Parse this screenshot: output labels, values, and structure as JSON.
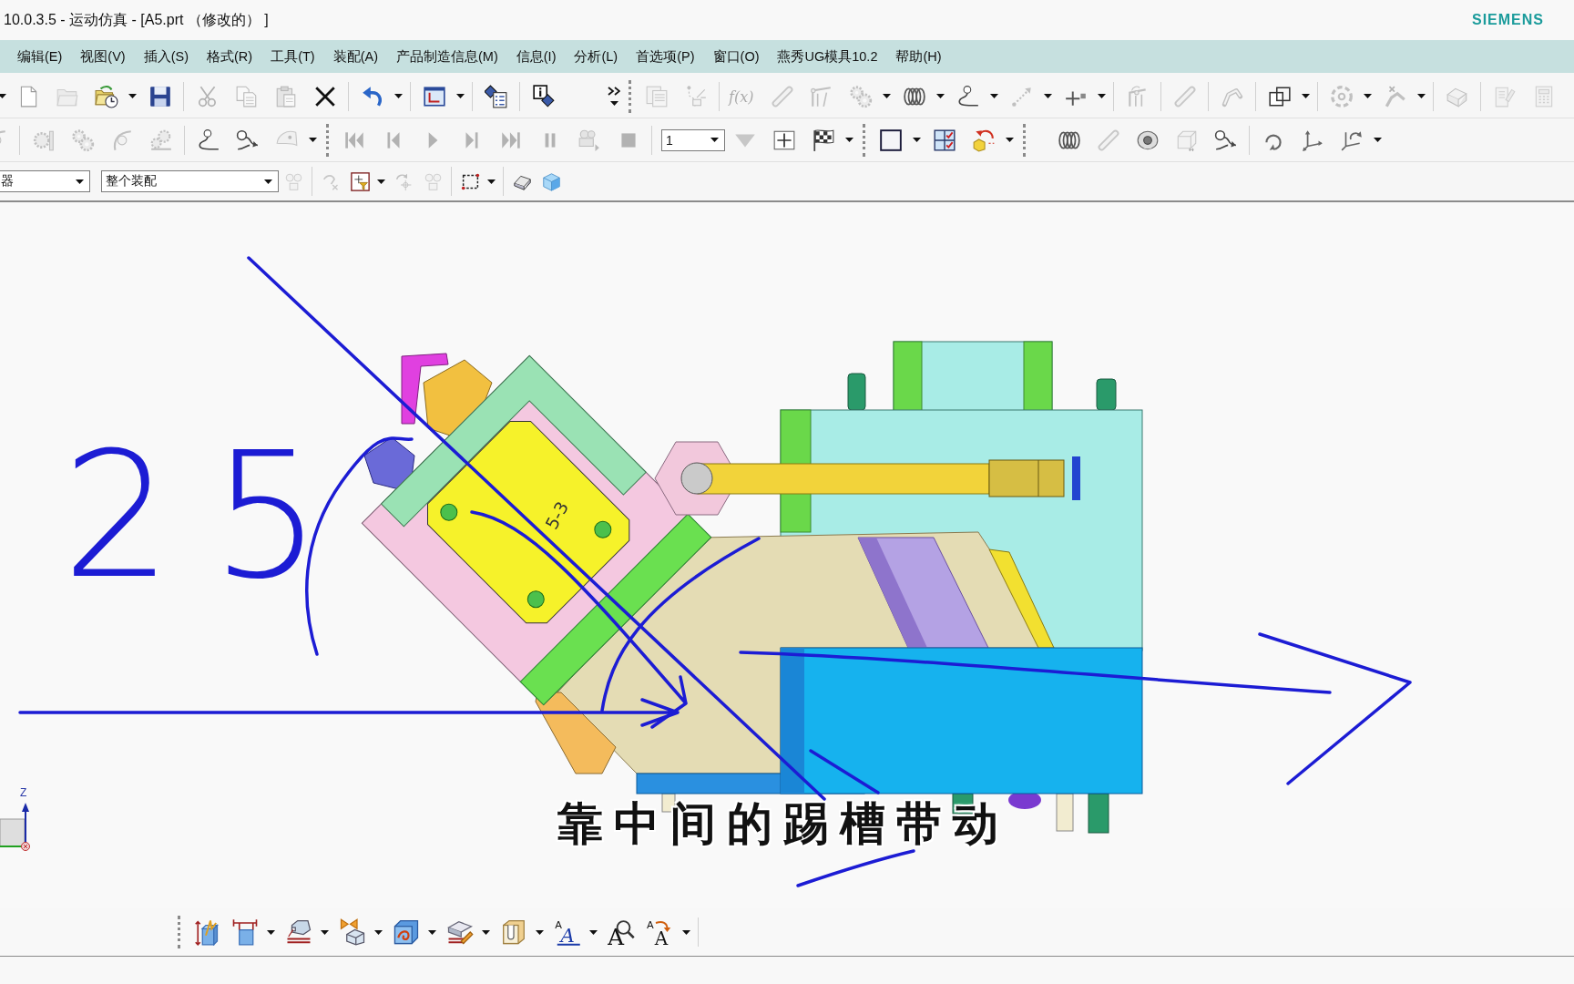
{
  "window": {
    "title": "10.0.3.5 - 运动仿真 - [A5.prt （修改的） ]",
    "brand": "SIEMENS"
  },
  "menu": [
    "编辑(E)",
    "视图(V)",
    "插入(S)",
    "格式(R)",
    "工具(T)",
    "装配(A)",
    "产品制造信息(M)",
    "信息(I)",
    "分析(L)",
    "首选项(P)",
    "窗口(O)",
    "燕秀UG模具10.2",
    "帮助(H)"
  ],
  "toolbars": [
    {
      "leading_caret": true,
      "groups": [
        [
          {
            "kind": "icon",
            "disabled": false,
            "dropdown": false
          },
          {
            "kind": "icon",
            "disabled": true,
            "dropdown": false
          },
          {
            "kind": "icon",
            "disabled": false,
            "dropdown": true
          },
          {
            "kind": "icon",
            "disabled": false,
            "dropdown": false
          }
        ],
        [
          {
            "kind": "icon",
            "disabled": true,
            "dropdown": false
          },
          {
            "kind": "icon",
            "disabled": true,
            "dropdown": false
          },
          {
            "kind": "icon",
            "disabled": true,
            "dropdown": false
          },
          {
            "kind": "icon",
            "disabled": false,
            "dropdown": false
          }
        ],
        [
          {
            "kind": "icon",
            "disabled": false,
            "dropdown": true
          }
        ],
        [
          {
            "kind": "icon",
            "disabled": false,
            "dropdown": true
          }
        ],
        [
          {
            "kind": "icon",
            "disabled": false,
            "dropdown": false
          }
        ],
        [
          {
            "kind": "icon",
            "disabled": false,
            "dropdown": false
          },
          {
            "kind": "overflow",
            "disabled": false,
            "dropdown": true
          }
        ],
        [
          {
            "kind": "icon",
            "disabled": true,
            "dropdown": false
          },
          {
            "kind": "icon",
            "disabled": true,
            "dropdown": false
          }
        ],
        [
          {
            "kind": "glyph",
            "glyphs": [
              "f(x)"
            ],
            "disabled": true,
            "dropdown": false
          },
          {
            "kind": "icon",
            "disabled": true,
            "dropdown": false
          },
          {
            "kind": "icon",
            "disabled": true,
            "dropdown": false
          },
          {
            "kind": "icon",
            "disabled": true,
            "dropdown": true
          },
          {
            "kind": "icon",
            "disabled": false,
            "dropdown": true
          },
          {
            "kind": "icon",
            "disabled": false,
            "dropdown": true
          },
          {
            "kind": "icon",
            "disabled": true,
            "dropdown": true
          },
          {
            "kind": "icon",
            "disabled": false,
            "dropdown": true
          }
        ],
        [
          {
            "kind": "icon",
            "disabled": true,
            "dropdown": false
          }
        ],
        [
          {
            "kind": "icon",
            "disabled": true,
            "dropdown": false
          }
        ],
        [
          {
            "kind": "icon",
            "disabled": true,
            "dropdown": false
          }
        ],
        [
          {
            "kind": "icon",
            "disabled": false,
            "dropdown": true
          }
        ],
        [
          {
            "kind": "icon",
            "disabled": true,
            "dropdown": true
          },
          {
            "kind": "icon",
            "disabled": true,
            "dropdown": true
          }
        ],
        [
          {
            "kind": "icon",
            "disabled": true,
            "dropdown": false
          }
        ],
        [
          {
            "kind": "icon",
            "disabled": true,
            "dropdown": false
          },
          {
            "kind": "icon",
            "disabled": true,
            "dropdown": false
          }
        ]
      ]
    },
    {
      "groups": [
        [
          {
            "kind": "icon",
            "disabled": true,
            "dropdown": false
          }
        ],
        [
          {
            "kind": "icon",
            "disabled": true,
            "dropdown": false
          },
          {
            "kind": "icon",
            "disabled": true,
            "dropdown": false
          },
          {
            "kind": "icon",
            "disabled": true,
            "dropdown": false
          },
          {
            "kind": "icon",
            "disabled": true,
            "dropdown": false
          }
        ],
        [
          {
            "kind": "icon",
            "disabled": false,
            "dropdown": false
          },
          {
            "kind": "icon",
            "disabled": false,
            "dropdown": false
          },
          {
            "kind": "icon",
            "disabled": true,
            "dropdown": true
          }
        ],
        [
          {
            "kind": "icon",
            "disabled": true,
            "dropdown": false
          },
          {
            "kind": "icon",
            "disabled": true,
            "dropdown": false
          },
          {
            "kind": "icon",
            "disabled": true,
            "dropdown": false
          },
          {
            "kind": "icon",
            "disabled": true,
            "dropdown": false
          },
          {
            "kind": "icon",
            "disabled": true,
            "dropdown": false
          },
          {
            "kind": "icon",
            "disabled": true,
            "dropdown": false
          },
          {
            "kind": "icon",
            "disabled": true,
            "dropdown": false
          },
          {
            "kind": "icon",
            "disabled": true,
            "dropdown": false
          }
        ],
        [
          {
            "kind": "select",
            "value": "1"
          },
          {
            "kind": "icon",
            "disabled": true,
            "dropdown": false
          },
          {
            "kind": "icon",
            "disabled": false,
            "dropdown": false
          },
          {
            "kind": "icon",
            "disabled": false,
            "dropdown": true
          }
        ],
        [
          {
            "kind": "icon",
            "disabled": false,
            "dropdown": true
          },
          {
            "kind": "icon",
            "disabled": false,
            "dropdown": false
          },
          {
            "kind": "icon",
            "disabled": false,
            "dropdown": true
          }
        ],
        [
          {
            "kind": "icon",
            "disabled": false,
            "dropdown": false
          },
          {
            "kind": "icon",
            "disabled": true,
            "dropdown": false
          },
          {
            "kind": "icon",
            "disabled": false,
            "dropdown": false
          },
          {
            "kind": "icon",
            "disabled": true,
            "dropdown": false
          },
          {
            "kind": "icon",
            "disabled": false,
            "dropdown": false
          }
        ],
        [
          {
            "kind": "icon",
            "disabled": false,
            "dropdown": false
          },
          {
            "kind": "icon",
            "disabled": false,
            "dropdown": false
          },
          {
            "kind": "icon",
            "disabled": false,
            "dropdown": true
          }
        ]
      ]
    },
    {
      "groups": [
        [
          {
            "kind": "select",
            "value": "器"
          },
          {
            "kind": "select",
            "value": "整个装配"
          },
          {
            "kind": "icon",
            "disabled": true,
            "dropdown": false
          }
        ],
        [
          {
            "kind": "icon",
            "disabled": true,
            "dropdown": false
          },
          {
            "kind": "icon",
            "disabled": false,
            "dropdown": true
          },
          {
            "kind": "icon",
            "disabled": true,
            "dropdown": false
          },
          {
            "kind": "icon",
            "disabled": true,
            "dropdown": false
          }
        ],
        [
          {
            "kind": "icon",
            "disabled": false,
            "dropdown": true
          }
        ],
        [
          {
            "kind": "icon",
            "disabled": false,
            "dropdown": false
          },
          {
            "kind": "icon",
            "disabled": false,
            "dropdown": false
          }
        ]
      ]
    }
  ],
  "viewport": {
    "part_label": "5-3",
    "annotation": "25",
    "axis_label": "Z",
    "subtitle": "靠中间的踢槽带动"
  },
  "bottom_toolbar": {
    "groups": [
      [
        {
          "kind": "icon",
          "disabled": false,
          "dropdown": false
        },
        {
          "kind": "icon",
          "disabled": false,
          "dropdown": true
        },
        {
          "kind": "icon",
          "disabled": false,
          "dropdown": true
        },
        {
          "kind": "icon",
          "disabled": false,
          "dropdown": true
        },
        {
          "kind": "icon",
          "disabled": false,
          "dropdown": true
        },
        {
          "kind": "icon",
          "disabled": false,
          "dropdown": true
        },
        {
          "kind": "icon",
          "disabled": false,
          "dropdown": true
        },
        {
          "kind": "glyph",
          "glyphs": [
            "A",
            "A"
          ],
          "disabled": false,
          "dropdown": true
        },
        {
          "kind": "glyph",
          "glyphs": [
            "A"
          ],
          "disabled": false,
          "dropdown": false
        },
        {
          "kind": "glyph",
          "glyphs": [
            "A",
            "A"
          ],
          "disabled": false,
          "dropdown": true
        }
      ]
    ]
  }
}
